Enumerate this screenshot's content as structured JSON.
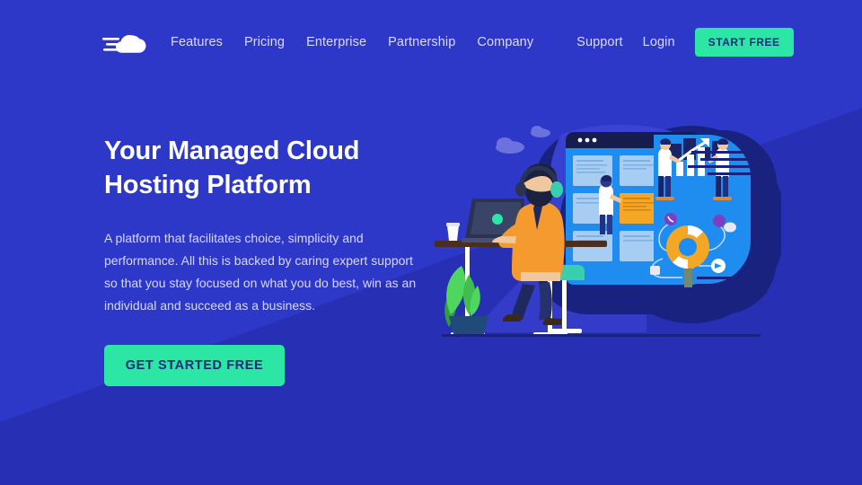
{
  "theme": {
    "bg_blue": "#2e38c8",
    "bg_blue_dark": "#2730b4",
    "accent_green": "#2ce6a5",
    "cta_text": "#1c2a7a",
    "nav_link": "#dcdcf6",
    "heading": "#ffffff",
    "body_text": "#d7d9f4"
  },
  "nav": {
    "logo_name": "cloud-speed-logo",
    "links": [
      {
        "label": "Features"
      },
      {
        "label": "Pricing"
      },
      {
        "label": "Enterprise"
      },
      {
        "label": "Partnership"
      },
      {
        "label": "Company"
      }
    ],
    "right_links": [
      {
        "label": "Support"
      },
      {
        "label": "Login"
      }
    ],
    "cta_label": "START FREE"
  },
  "hero": {
    "headline_line1": "Your Managed Cloud",
    "headline_line2": "Hosting Platform",
    "subtext": "A platform that facilitates choice, simplicity and performance. All this is backed by caring expert support so that you stay focused on what you do best, win as an individual and succeed as a business.",
    "cta_label": "GET STARTED FREE"
  },
  "illustration": {
    "name": "managed-cloud-hosting-illustration",
    "description": "Bearded man with headphones working on a laptop at a desk with a plant and coffee cup, beside a browser window showing task cards, two people holding a growth bar chart, and a lifebuoy support icon"
  }
}
